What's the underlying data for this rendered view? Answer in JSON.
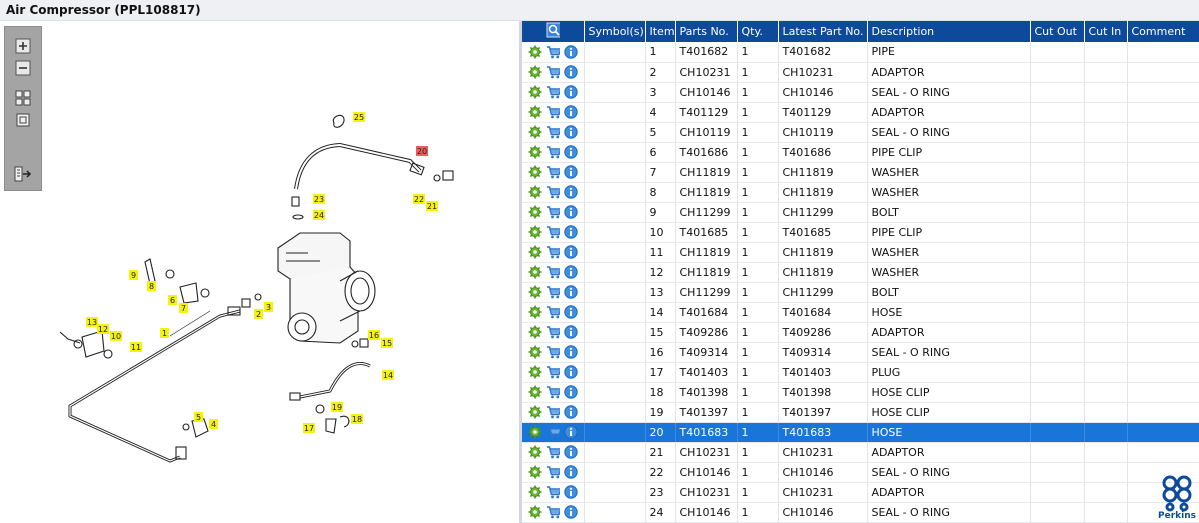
{
  "window": {
    "title": "Air Compressor (PPL108817)"
  },
  "toolbar": {
    "tools": [
      {
        "icon": "zoom-in-icon"
      },
      {
        "icon": "zoom-out-icon"
      },
      {
        "icon": "grid-view-icon"
      },
      {
        "icon": "single-view-icon"
      },
      {
        "icon": "export-icon"
      }
    ]
  },
  "diagram": {
    "callouts": [
      "25",
      "20",
      "23",
      "24",
      "22",
      "21",
      "9",
      "8",
      "6",
      "7",
      "2",
      "3",
      "1",
      "13",
      "12",
      "10",
      "11",
      "16",
      "15",
      "14",
      "19",
      "17",
      "18",
      "5",
      "4"
    ],
    "selected_callout": "20"
  },
  "table": {
    "columns": [
      "Symbol(s)",
      "Item",
      "Parts No.",
      "Qty.",
      "Latest Part No.",
      "Description",
      "Cut Out",
      "Cut In",
      "Comment"
    ],
    "header_icon": "search-icon",
    "row_icons": [
      "gear-icon",
      "cart-icon",
      "info-icon"
    ],
    "selected_item": "20",
    "rows": [
      {
        "symbol": "",
        "item": "1",
        "part": "T401682",
        "qty": "1",
        "latest": "T401682",
        "desc": "PIPE",
        "cut_out": "",
        "cut_in": "",
        "comment": ""
      },
      {
        "symbol": "",
        "item": "2",
        "part": "CH10231",
        "qty": "1",
        "latest": "CH10231",
        "desc": "ADAPTOR",
        "cut_out": "",
        "cut_in": "",
        "comment": ""
      },
      {
        "symbol": "",
        "item": "3",
        "part": "CH10146",
        "qty": "1",
        "latest": "CH10146",
        "desc": "SEAL - O RING",
        "cut_out": "",
        "cut_in": "",
        "comment": ""
      },
      {
        "symbol": "",
        "item": "4",
        "part": "T401129",
        "qty": "1",
        "latest": "T401129",
        "desc": "ADAPTOR",
        "cut_out": "",
        "cut_in": "",
        "comment": ""
      },
      {
        "symbol": "",
        "item": "5",
        "part": "CH10119",
        "qty": "1",
        "latest": "CH10119",
        "desc": "SEAL - O RING",
        "cut_out": "",
        "cut_in": "",
        "comment": ""
      },
      {
        "symbol": "",
        "item": "6",
        "part": "T401686",
        "qty": "1",
        "latest": "T401686",
        "desc": "PIPE CLIP",
        "cut_out": "",
        "cut_in": "",
        "comment": ""
      },
      {
        "symbol": "",
        "item": "7",
        "part": "CH11819",
        "qty": "1",
        "latest": "CH11819",
        "desc": "WASHER",
        "cut_out": "",
        "cut_in": "",
        "comment": ""
      },
      {
        "symbol": "",
        "item": "8",
        "part": "CH11819",
        "qty": "1",
        "latest": "CH11819",
        "desc": "WASHER",
        "cut_out": "",
        "cut_in": "",
        "comment": ""
      },
      {
        "symbol": "",
        "item": "9",
        "part": "CH11299",
        "qty": "1",
        "latest": "CH11299",
        "desc": "BOLT",
        "cut_out": "",
        "cut_in": "",
        "comment": ""
      },
      {
        "symbol": "",
        "item": "10",
        "part": "T401685",
        "qty": "1",
        "latest": "T401685",
        "desc": "PIPE CLIP",
        "cut_out": "",
        "cut_in": "",
        "comment": ""
      },
      {
        "symbol": "",
        "item": "11",
        "part": "CH11819",
        "qty": "1",
        "latest": "CH11819",
        "desc": "WASHER",
        "cut_out": "",
        "cut_in": "",
        "comment": ""
      },
      {
        "symbol": "",
        "item": "12",
        "part": "CH11819",
        "qty": "1",
        "latest": "CH11819",
        "desc": "WASHER",
        "cut_out": "",
        "cut_in": "",
        "comment": ""
      },
      {
        "symbol": "",
        "item": "13",
        "part": "CH11299",
        "qty": "1",
        "latest": "CH11299",
        "desc": "BOLT",
        "cut_out": "",
        "cut_in": "",
        "comment": ""
      },
      {
        "symbol": "",
        "item": "14",
        "part": "T401684",
        "qty": "1",
        "latest": "T401684",
        "desc": "HOSE",
        "cut_out": "",
        "cut_in": "",
        "comment": ""
      },
      {
        "symbol": "",
        "item": "15",
        "part": "T409286",
        "qty": "1",
        "latest": "T409286",
        "desc": "ADAPTOR",
        "cut_out": "",
        "cut_in": "",
        "comment": ""
      },
      {
        "symbol": "",
        "item": "16",
        "part": "T409314",
        "qty": "1",
        "latest": "T409314",
        "desc": "SEAL - O RING",
        "cut_out": "",
        "cut_in": "",
        "comment": ""
      },
      {
        "symbol": "",
        "item": "17",
        "part": "T401403",
        "qty": "1",
        "latest": "T401403",
        "desc": "PLUG",
        "cut_out": "",
        "cut_in": "",
        "comment": ""
      },
      {
        "symbol": "",
        "item": "18",
        "part": "T401398",
        "qty": "1",
        "latest": "T401398",
        "desc": "HOSE CLIP",
        "cut_out": "",
        "cut_in": "",
        "comment": ""
      },
      {
        "symbol": "",
        "item": "19",
        "part": "T401397",
        "qty": "1",
        "latest": "T401397",
        "desc": "HOSE CLIP",
        "cut_out": "",
        "cut_in": "",
        "comment": ""
      },
      {
        "symbol": "",
        "item": "20",
        "part": "T401683",
        "qty": "1",
        "latest": "T401683",
        "desc": "HOSE",
        "cut_out": "",
        "cut_in": "",
        "comment": ""
      },
      {
        "symbol": "",
        "item": "21",
        "part": "CH10231",
        "qty": "1",
        "latest": "CH10231",
        "desc": "ADAPTOR",
        "cut_out": "",
        "cut_in": "",
        "comment": ""
      },
      {
        "symbol": "",
        "item": "22",
        "part": "CH10146",
        "qty": "1",
        "latest": "CH10146",
        "desc": "SEAL - O RING",
        "cut_out": "",
        "cut_in": "",
        "comment": ""
      },
      {
        "symbol": "",
        "item": "23",
        "part": "CH10231",
        "qty": "1",
        "latest": "CH10231",
        "desc": "ADAPTOR",
        "cut_out": "",
        "cut_in": "",
        "comment": ""
      },
      {
        "symbol": "",
        "item": "24",
        "part": "CH10146",
        "qty": "1",
        "latest": "CH10146",
        "desc": "SEAL - O RING",
        "cut_out": "",
        "cut_in": "",
        "comment": ""
      }
    ]
  },
  "brand": {
    "name": "Perkins",
    "icon": "perkins-logo-icon",
    "color": "#0d4a9b"
  },
  "colors": {
    "header_bg": "#0d4a9b",
    "selected_row": "#1976d8",
    "callout": "#f5f20b",
    "callout_selected": "#f25b5b"
  }
}
